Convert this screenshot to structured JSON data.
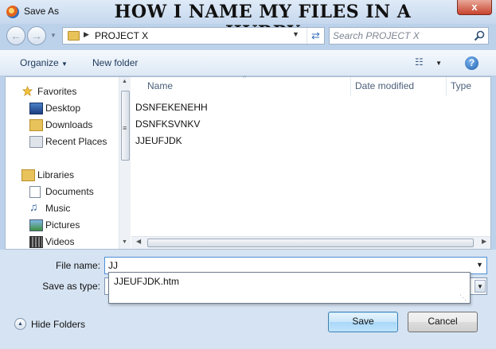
{
  "window": {
    "title": "Save As",
    "caption": "HOW I NAME MY FILES IN A HURRY",
    "close_glyph": "x"
  },
  "address": {
    "path": "PROJECT X",
    "search_placeholder": "Search PROJECT X"
  },
  "toolbar": {
    "organize_label": "Organize",
    "new_folder_label": "New folder",
    "help_glyph": "?"
  },
  "nav": {
    "favorites": [
      {
        "label": "Favorites",
        "icon": "star-icon"
      },
      {
        "label": "Desktop",
        "icon": "desktop-icon"
      },
      {
        "label": "Downloads",
        "icon": "downloads-folder-icon"
      },
      {
        "label": "Recent Places",
        "icon": "recent-places-icon"
      }
    ],
    "libraries": [
      {
        "label": "Libraries",
        "icon": "libraries-icon"
      },
      {
        "label": "Documents",
        "icon": "documents-icon"
      },
      {
        "label": "Music",
        "icon": "music-icon"
      },
      {
        "label": "Pictures",
        "icon": "pictures-icon"
      },
      {
        "label": "Videos",
        "icon": "videos-icon"
      }
    ]
  },
  "file_list": {
    "columns": [
      "Name",
      "Date modified",
      "Type"
    ],
    "files": [
      "DSNFEKENEHH",
      "DSNFKSVNKV",
      "JJEUFJDK"
    ]
  },
  "form": {
    "file_name_label": "File name:",
    "file_name_value": "JJ",
    "save_as_type_label": "Save as type:",
    "autocomplete_suggestion": "JJEUFJDK.htm",
    "hide_folders_label": "Hide Folders",
    "save_label": "Save",
    "cancel_label": "Cancel"
  },
  "colors": {
    "accent": "#4d8fd6",
    "frame": "#bcd2ea",
    "close_red": "#c7432d"
  }
}
